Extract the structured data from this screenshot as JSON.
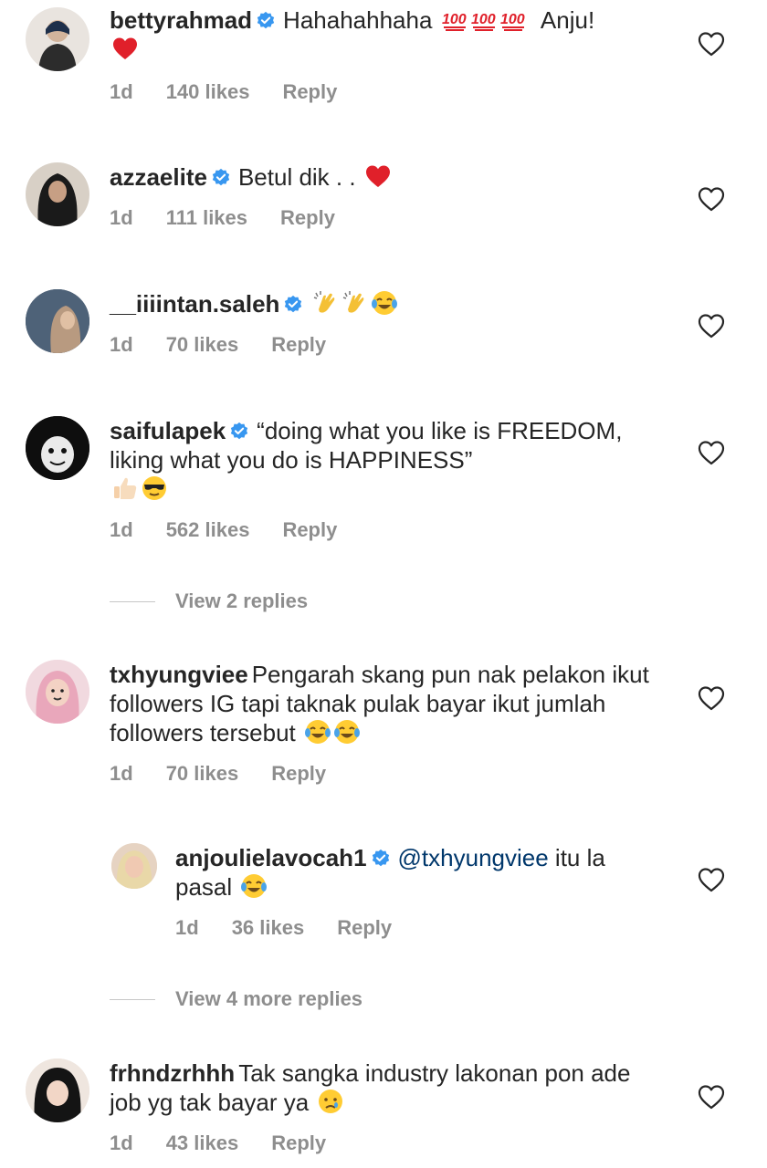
{
  "comments": [
    {
      "username": "bettyrahmad",
      "text": "Hahahahhaha",
      "text_after": "Anju!",
      "emojis": [
        "hundred-points-icon",
        "hundred-points-icon",
        "hundred-points-icon",
        "red-heart-icon"
      ],
      "verified": true,
      "time": "1d",
      "likes": "140 likes",
      "reply": "Reply"
    },
    {
      "username": "azzaelite",
      "text": "Betul  dik . .",
      "emojis": [
        "red-heart-icon"
      ],
      "verified": true,
      "time": "1d",
      "likes": "111 likes",
      "reply": "Reply"
    },
    {
      "username": "__iiiintan.saleh",
      "text": "",
      "emojis": [
        "clapping-hands-icon",
        "clapping-hands-icon",
        "tears-of-joy-icon"
      ],
      "verified": true,
      "time": "1d",
      "likes": "70 likes",
      "reply": "Reply"
    },
    {
      "username": "saifulapek",
      "text": "“doing what you like is FREEDOM, liking what you do is HAPPINESS”",
      "emojis": [
        "thumbs-up-icon",
        "sunglasses-face-icon"
      ],
      "verified": true,
      "time": "1d",
      "likes": "562 likes",
      "reply": "Reply",
      "view_replies": "View 2 replies"
    },
    {
      "username": "txhyungviee",
      "text": "Pengarah skang pun nak pelakon ikut followers IG tapi taknak pulak bayar ikut jumlah followers tersebut",
      "emojis": [
        "tears-of-joy-icon",
        "tears-of-joy-icon"
      ],
      "verified": false,
      "time": "1d",
      "likes": "70 likes",
      "reply": "Reply"
    },
    {
      "username": "anjoulielavocah1",
      "mention": "@txhyungviee",
      "text": "itu la pasal",
      "emojis": [
        "tears-of-joy-icon"
      ],
      "verified": true,
      "time": "1d",
      "likes": "36 likes",
      "reply": "Reply",
      "view_replies": "View 4 more replies"
    },
    {
      "username": "frhndzrhhh",
      "text": "Tak sangka industry lakonan pon ade job yg tak bayar ya",
      "emojis": [
        "crying-face-icon"
      ],
      "verified": false,
      "time": "1d",
      "likes": "43 likes",
      "reply": "Reply"
    }
  ],
  "colors": {
    "text": "#262626",
    "meta": "#8e8e8e",
    "verified": "#3897f0",
    "mention": "#00376b"
  }
}
